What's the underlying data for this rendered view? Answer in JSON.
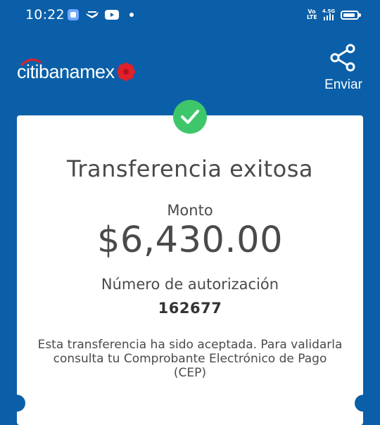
{
  "status_bar": {
    "time": "10:22",
    "network_tag": "4.5G",
    "volte_tag_top": "Vo",
    "volte_tag_bottom": "LTE",
    "icons": [
      "app-icon",
      "bird-icon",
      "youtube-icon",
      "dot-icon",
      "volte-icon",
      "signal-icon",
      "battery-icon"
    ]
  },
  "header": {
    "logo_text": "citibanamex",
    "share_label": "Enviar",
    "share_icon": "share-icon"
  },
  "colors": {
    "background": "#0a5fa8",
    "success": "#3ec76a",
    "logo_red": "#e0202a",
    "text": "#4a4a4a"
  },
  "result": {
    "status_icon": "check-icon",
    "title": "Transferencia exitosa",
    "amount_label": "Monto",
    "amount": "$6,430.00",
    "auth_label": "Número de autorización",
    "auth_number": "162677",
    "message_line1": "Esta transferencia ha sido aceptada. Para validarla",
    "message_line2": "consulta tu Comprobante Electrónico de Pago",
    "message_line3": "(CEP)"
  }
}
